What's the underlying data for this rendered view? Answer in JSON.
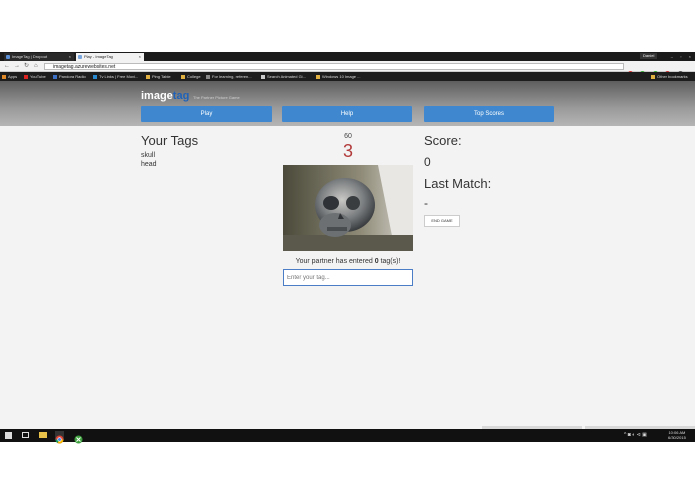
{
  "browser": {
    "tabs": [
      {
        "label": "ImageTag | Dropout",
        "close": "×"
      },
      {
        "label": "Play - ImageTag",
        "close": "×"
      }
    ],
    "user": "Daniel",
    "window_controls": [
      "–",
      "▫",
      "×"
    ],
    "url": "imagetag.azurewebsites.net",
    "bookmarks": [
      "Apps",
      "YouTube",
      "Pandora Radio",
      "Tv Links | Free Movi...",
      "Ping Table",
      "College",
      "For learning, referen...",
      "Search Animated Gi...",
      "Windows 10 Image ...",
      "Other bookmarks"
    ]
  },
  "site": {
    "logo_main": "image",
    "logo_accent": "tag",
    "tagline": "The Partner Picture Game",
    "nav": {
      "play": "Play",
      "help": "Help",
      "top_scores": "Top Scores"
    }
  },
  "game": {
    "your_tags_title": "Your Tags",
    "tags": [
      "skull",
      "head"
    ],
    "timer": "60",
    "count": "3",
    "partner_prefix": "Your partner has entered",
    "partner_count": "0",
    "partner_suffix": "tag(s)!",
    "input_placeholder": "Enter your tag...",
    "score_label": "Score:",
    "score_value": "0",
    "last_match_label": "Last Match:",
    "last_match_value": "-",
    "end_game": "END GAME"
  },
  "taskbar": {
    "tray": "^ ◙ ◐ ⊲ ▣",
    "time": "10:06 AM",
    "date": "6/30/2015"
  },
  "colors": {
    "accent": "#3f88cf",
    "count": "#b23a3a",
    "logo_accent": "#1f62b8"
  }
}
